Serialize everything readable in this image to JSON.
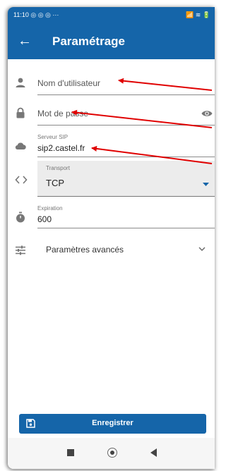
{
  "status_bar": {
    "time": "11:10 ◎ ◎ ◎ ···",
    "icons": "📶 ≋ 🔋"
  },
  "app_bar": {
    "title": "Paramétrage"
  },
  "fields": {
    "username": {
      "placeholder": "Nom d'utilisateur"
    },
    "password": {
      "placeholder": "Mot de passe"
    },
    "sip_server": {
      "label": "Serveur SIP",
      "value": "sip2.castel.fr"
    },
    "transport": {
      "label": "Transport",
      "value": "TCP"
    },
    "expiration": {
      "label": "Expiration",
      "value": "600"
    }
  },
  "advanced": {
    "label": "Paramètres avancés"
  },
  "save_button": {
    "label": "Enregistrer"
  },
  "colors": {
    "primary": "#1565a9",
    "annotation": "#e00000"
  }
}
